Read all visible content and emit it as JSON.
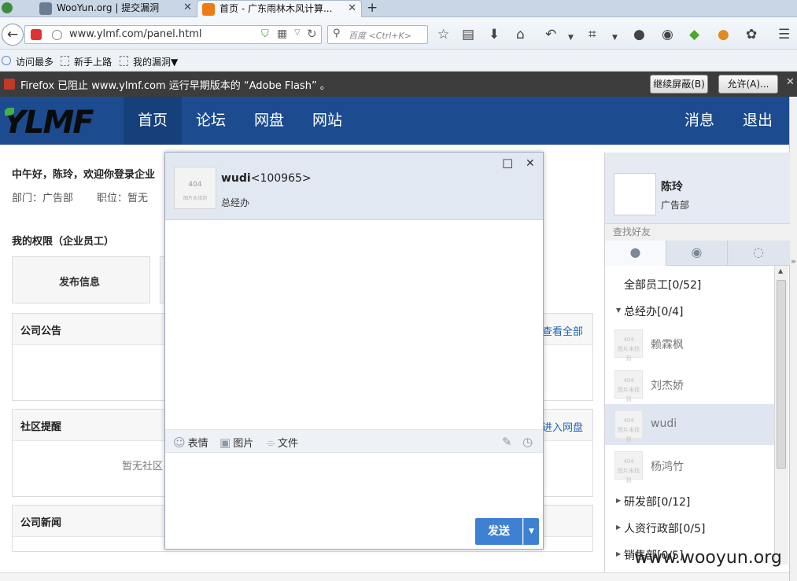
{
  "browser": {
    "tabs": [
      {
        "title": "WooYun.org | 提交漏洞",
        "close": "✕"
      },
      {
        "title": "首页 - 广东雨林木风计算...",
        "close": "✕"
      }
    ],
    "new_tab": "+",
    "url": "www.ylmf.com/panel.html",
    "search_placeholder": "百度 <Ctrl+K>",
    "bookmarks": [
      "访问最多",
      "新手上路",
      "我的漏洞▼"
    ],
    "flash_notice": "Firefox 已阻止 www.ylmf.com 运行早期版本的 “Adobe Flash” 。",
    "flash_buttons": {
      "block": "继续屏蔽(B)",
      "allow": "允许(A)..."
    }
  },
  "site": {
    "logo": "YLMF",
    "nav": [
      "首页",
      "论坛",
      "网盘",
      "网站"
    ],
    "nav_right": [
      "消息",
      "退出"
    ]
  },
  "dashboard": {
    "greeting": "中午好，陈玲，欢迎你登录企业",
    "dept": "部门：广告部",
    "position": "职位：暂无",
    "perm_title": "我的权限（企业员工）",
    "publish_btn": "发布信息",
    "announce_title": "公司公告",
    "announce_link": "查看全部",
    "community_title": "社区提醒",
    "community_link": "进入网盘",
    "community_empty": "暂无社区",
    "news_title": "公司新闻"
  },
  "chat": {
    "name": "wudi",
    "uid": "<100965>",
    "dept": "总经办",
    "avatar_text": "404",
    "avatar_sub": "图片未找到",
    "toolbar": {
      "emoji": "表情",
      "image": "图片",
      "file": "文件"
    },
    "send": "发送",
    "maximize": "□",
    "close": "✕"
  },
  "panel": {
    "user_name": "陈玲",
    "user_dept": "广告部",
    "search_label": "查找好友",
    "all_staff": "全部员工[0/52]",
    "groups": [
      {
        "name": "总经办[0/4]",
        "expanded": true
      },
      {
        "name": "研发部[0/12]",
        "expanded": false
      },
      {
        "name": "人资行政部[0/5]",
        "expanded": false
      },
      {
        "name": "销售部[0/5]",
        "expanded": false
      }
    ],
    "members": [
      "赖霖枫",
      "刘杰娇",
      "wudi",
      "杨鸿竹"
    ],
    "avatar_text": "404",
    "avatar_sub": "图片未找到"
  },
  "watermark": "www.wooyun.org"
}
